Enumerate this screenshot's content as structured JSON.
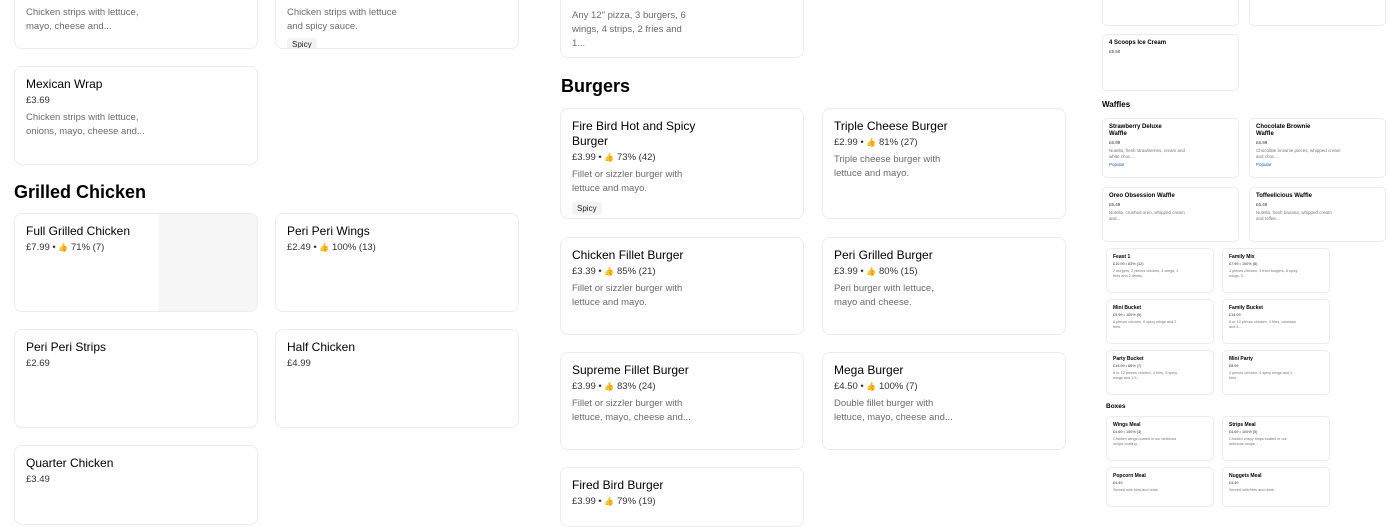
{
  "col1": {
    "top_card_a_desc": "Chicken strips with lettuce, mayo, cheese and...",
    "mexican_wrap": {
      "name": "Mexican Wrap",
      "price": "£3.69",
      "desc": "Chicken strips with lettuce, onions, mayo, cheese and..."
    },
    "section_grilled": "Grilled Chicken",
    "full_grilled": {
      "name": "Full Grilled Chicken",
      "price": "£7.99",
      "rating": "71% (7)"
    },
    "peri_strips": {
      "name": "Peri Peri Strips",
      "price": "£2.69"
    },
    "quarter_chicken": {
      "name": "Quarter Chicken",
      "price": "£3.49"
    }
  },
  "col2": {
    "top_card_b_desc": "Chicken strips with lettuce and spicy sauce.",
    "top_card_b_tag": "Spicy",
    "peri_wings": {
      "name": "Peri Peri Wings",
      "price": "£2.49",
      "rating": "100% (13)"
    },
    "half_chicken": {
      "name": "Half Chicken",
      "price": "£4.99"
    }
  },
  "col3": {
    "top_card_c_desc": "Any 12\" pizza, 3 burgers, 6 wings, 4 strips, 2 fries and 1...",
    "section_burgers": "Burgers",
    "fire_bird": {
      "name": "Fire Bird Hot and Spicy Burger",
      "price": "£3.99",
      "rating": "73% (42)",
      "desc": "Fillet or sizzler burger with lettuce and mayo.",
      "tag": "Spicy"
    },
    "chicken_fillet": {
      "name": "Chicken Fillet Burger",
      "price": "£3.39",
      "rating": "85% (21)",
      "desc": "Fillet or sizzler burger with lettuce and mayo."
    },
    "supreme_fillet": {
      "name": "Supreme Fillet Burger",
      "price": "£3.99",
      "rating": "83% (24)",
      "desc": "Fillet or sizzler burger with lettuce, mayo, cheese and..."
    },
    "fired_bird": {
      "name": "Fired Bird Burger",
      "price": "£3.99",
      "rating": "79% (19)"
    }
  },
  "col4": {
    "triple_cheese": {
      "name": "Triple Cheese Burger",
      "price": "£2.99",
      "rating": "81% (27)",
      "desc": "Triple cheese burger with lettuce and mayo."
    },
    "peri_grilled": {
      "name": "Peri Grilled Burger",
      "price": "£3.99",
      "rating": "80% (15)",
      "desc": "Peri burger with lettuce, mayo and cheese."
    },
    "mega": {
      "name": "Mega Burger",
      "price": "£4.50",
      "rating": "100% (7)",
      "desc": "Double fillet burger with lettuce, mayo, cheese and..."
    }
  },
  "right": {
    "ice_cream": {
      "name": "4 Scoops Ice Cream",
      "price": "£5.50"
    },
    "section_waffles": "Waffles",
    "strawberry": {
      "name": "Strawberry Deluxe Waffle",
      "price": "£6.99",
      "desc": "Nutella, fresh strawberries, cream and white choc...",
      "tag": "Popular"
    },
    "choc_brownie": {
      "name": "Chocolate Brownie Waffle",
      "price": "£6.99",
      "desc": "Chocolate brownie pieces, whipped cream and choc...",
      "tag": "Popular"
    },
    "oreo": {
      "name": "Oreo Obsession Waffle",
      "price": "£6.49",
      "desc": "Nutella, crushed oreo, whipped cream and..."
    },
    "toffeelicious": {
      "name": "Toffeelicious Waffle",
      "price": "£6.49",
      "desc": "Nutella, fresh banana, whipped cream and toffee..."
    },
    "feast1": {
      "name": "Feast 1",
      "price": "£10.99 • 83% (12)",
      "desc": "2 burgers, 2 pieces chicken, 4 wings, 2 fries and 2 drinks."
    },
    "family_mix": {
      "name": "Family Mix",
      "price": "£7.99 • 100% (8)",
      "desc": "4 pieces chicken, 3 fried burgers, 8 spicy wings, 3..."
    },
    "mini_bucket": {
      "name": "Mini Bucket",
      "price": "£9.99 • 100% (5)",
      "desc": "6 pieces chicken, 6 spicy wings and 2 fries."
    },
    "family_bucket": {
      "name": "Family Bucket",
      "price": "£14.99",
      "desc": "8 or 12 pieces chicken, 4 fries, coleslaw and 4..."
    },
    "party_bucket": {
      "name": "Party Bucket",
      "price": "£14.99 • 86% (7)",
      "desc": "8 or 12 pieces chicken, 4 fries, 8 spicy wings and 1.5..."
    },
    "mini_party": {
      "name": "Mini Party",
      "price": "£8.99",
      "desc": "4 pieces chicken, 4 spicy wings and 2 fries."
    },
    "section_boxes": "Boxes",
    "wings_meal": {
      "name": "Wings Meal",
      "price": "£4.69 • 100% (3)",
      "desc": "Chicken wings coated in our delicious recipe coating..."
    },
    "strips_meal": {
      "name": "Strips Meal",
      "price": "£4.69 • 100% (5)",
      "desc": "Chicken crispy strips coated in our delicious recipe..."
    },
    "popcorn_meal": {
      "name": "Popcorn Meal",
      "price": "£4.49",
      "desc": "Served with fries and drink."
    },
    "nuggets_meal": {
      "name": "Nuggets Meal",
      "price": "£4.49",
      "desc": "Served with fries and drink."
    }
  },
  "icons": {
    "rating": "thumbs-up-icon"
  },
  "colors": {
    "border": "#ececec",
    "text_muted": "#6b6b6b",
    "popular": "#1a5fb4"
  }
}
